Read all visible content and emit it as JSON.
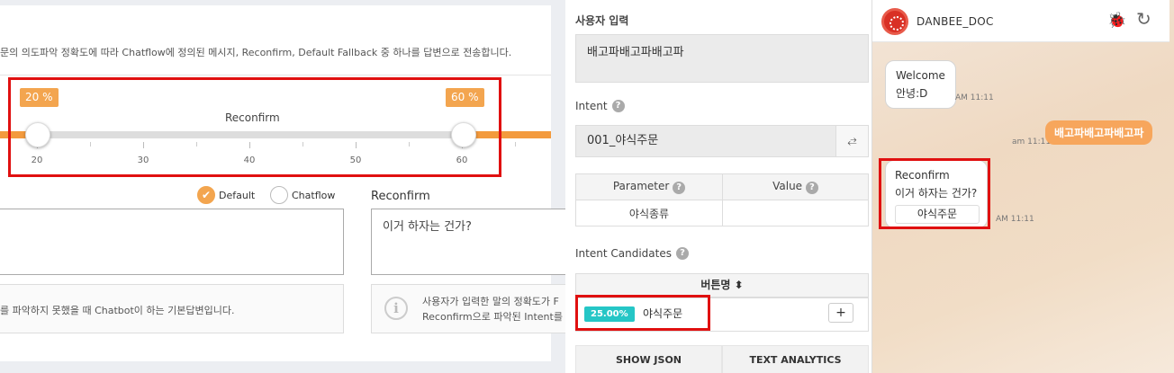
{
  "left": {
    "description": "문의 의도파악 정확도에 따라 Chatflow에 정의된 메시지, Reconfirm, Default Fallback 중 하나를 답변으로 전송합니다.",
    "slider": {
      "title": "Reconfirm",
      "low_badge": "20 %",
      "high_badge": "60 %",
      "low_value": 20,
      "high_value": 60,
      "tick_labels": [
        "20",
        "30",
        "40",
        "50",
        "60"
      ]
    },
    "radio_default": "Default",
    "radio_chatflow": "Chatflow",
    "reconfirm_label": "Reconfirm",
    "reconfirm_text": "이거 하자는 건가?",
    "info_left": "를 파악하지 못했을 때 Chatbot이 하는 기본답변입니다.",
    "info_right_line1": "사용자가 입력한 말의 정확도가 F",
    "info_right_line2": "Reconfirm으로 파악된 Intent를"
  },
  "middle": {
    "user_input_label": "사용자 입력",
    "user_input_value": "배고파배고파배고파",
    "intent_label": "Intent",
    "intent_value": "001_야식주문",
    "swap_icon": "⥄",
    "param_headers": [
      "Parameter",
      "Value"
    ],
    "param_rows": [
      [
        "야식종류",
        ""
      ]
    ],
    "candidates_label": "Intent Candidates",
    "candidates_header": "버튼명 ⬍",
    "candidate_pct": "25.00%",
    "candidate_name": "야식주문",
    "plus_label": "+",
    "show_json": "SHOW JSON",
    "text_analytics": "TEXT ANALYTICS"
  },
  "chat": {
    "title": "DANBEE_DOC",
    "bug_icon": "🐞",
    "refresh_icon": "↻",
    "msg1_line1": "Welcome",
    "msg1_line2": "안녕:D",
    "msg1_time": "AM 11:11",
    "user_msg": "배고파배고파배고파",
    "user_time": "am 11:11",
    "msg2_line1": "Reconfirm",
    "msg2_line2": "이거 하자는 건가?",
    "msg2_button": "야식주문",
    "msg2_time": "AM 11:11"
  },
  "colors": {
    "accent": "#f39a3d",
    "highlight": "#e01010",
    "teal": "#25c6c6"
  }
}
